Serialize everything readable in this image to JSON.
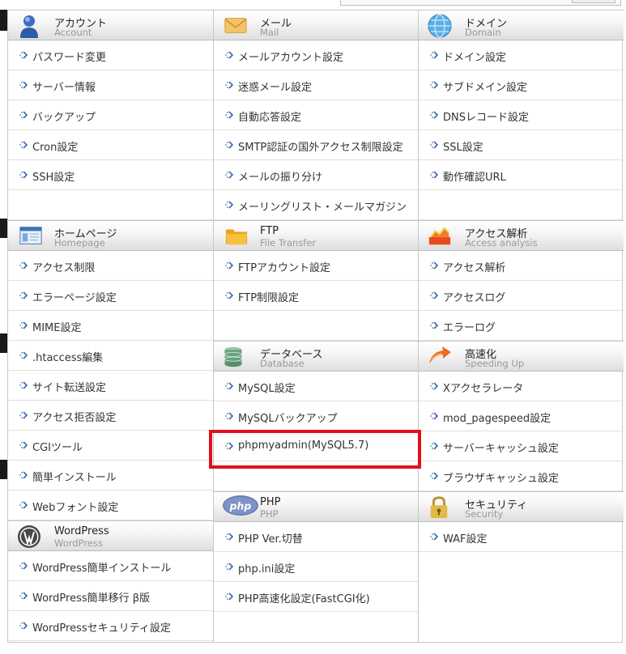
{
  "columns": [
    {
      "sections": [
        {
          "key": "account",
          "title": "アカウント",
          "subtitle": "Account",
          "icon": "user-icon",
          "items": [
            "パスワード変更",
            "サーバー情報",
            "バックアップ",
            "Cron設定",
            "SSH設定",
            ""
          ]
        },
        {
          "key": "homepage",
          "title": "ホームページ",
          "subtitle": "Homepage",
          "icon": "webpage-icon",
          "items": [
            "アクセス制限",
            "エラーページ設定",
            "MIME設定",
            ".htaccess編集",
            "サイト転送設定",
            "アクセス拒否設定",
            "CGIツール",
            "簡単インストール",
            "Webフォント設定"
          ]
        },
        {
          "key": "wordpress",
          "title": "WordPress",
          "subtitle": "WordPress",
          "icon": "wordpress-logo-icon",
          "items": [
            "WordPress簡単インストール",
            "WordPress簡単移行 β版",
            "WordPressセキュリティ設定"
          ]
        }
      ]
    },
    {
      "sections": [
        {
          "key": "mail",
          "title": "メール",
          "subtitle": "Mail",
          "icon": "envelope-icon",
          "items": [
            "メールアカウント設定",
            "迷惑メール設定",
            "自動応答設定",
            "SMTP認証の国外アクセス制限設定",
            "メールの振り分け",
            "メーリングリスト・メールマガジン"
          ]
        },
        {
          "key": "ftp",
          "title": "FTP",
          "subtitle": "File Transfer",
          "icon": "folder-icon",
          "items": [
            "FTPアカウント設定",
            "FTP制限設定",
            ""
          ]
        },
        {
          "key": "database",
          "title": "データベース",
          "subtitle": "Database",
          "icon": "database-icon",
          "items": [
            "MySQL設定",
            "MySQLバックアップ",
            "phpmyadmin(MySQL5.7)",
            ""
          ]
        },
        {
          "key": "php",
          "title": "PHP",
          "subtitle": "PHP",
          "icon": "php-logo-icon",
          "items": [
            "PHP Ver.切替",
            "php.ini設定",
            "PHP高速化設定(FastCGI化)"
          ]
        }
      ]
    },
    {
      "sections": [
        {
          "key": "domain",
          "title": "ドメイン",
          "subtitle": "Domain",
          "icon": "globe-icon",
          "items": [
            "ドメイン設定",
            "サブドメイン設定",
            "DNSレコード設定",
            "SSL設定",
            "動作確認URL",
            ""
          ]
        },
        {
          "key": "access",
          "title": "アクセス解析",
          "subtitle": "Access analysis",
          "icon": "chart-icon",
          "items": [
            "アクセス解析",
            "アクセスログ",
            "エラーログ"
          ]
        },
        {
          "key": "speed",
          "title": "高速化",
          "subtitle": "Speeding Up",
          "icon": "speed-arrow-icon",
          "items": [
            "Xアクセラレータ",
            "mod_pagespeed設定",
            "サーバーキャッシュ設定",
            "ブラウザキャッシュ設定"
          ]
        },
        {
          "key": "security",
          "title": "セキュリティ",
          "subtitle": "Security",
          "icon": "padlock-icon",
          "items": [
            "WAF設定"
          ]
        }
      ]
    }
  ],
  "highlight_label": "phpmyadmin(MySQL5.7)",
  "colors": {
    "highlight": "#e0101c",
    "border": "#c8c8c8",
    "subtitle": "#9a9a9a"
  }
}
